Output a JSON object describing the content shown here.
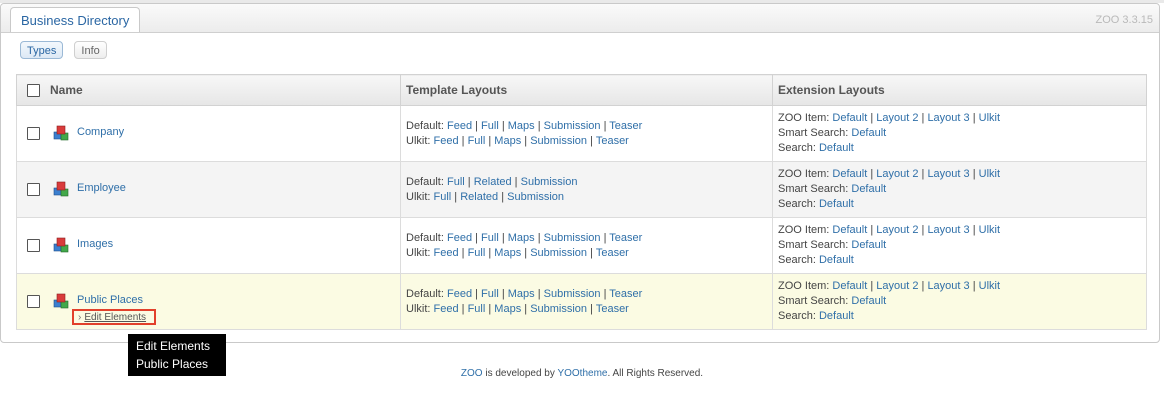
{
  "app_tab": "Business Directory",
  "version": "ZOO 3.3.15",
  "subtabs": {
    "types": "Types",
    "info": "Info"
  },
  "table": {
    "headers": {
      "name": "Name",
      "template": "Template Layouts",
      "extension": "Extension Layouts"
    },
    "rows": [
      {
        "name": "Company",
        "template": [
          {
            "label": "Default:",
            "links": [
              "Feed",
              "Full",
              "Maps",
              "Submission",
              "Teaser"
            ]
          },
          {
            "label": "Ulkit:",
            "links": [
              "Feed",
              "Full",
              "Maps",
              "Submission",
              "Teaser"
            ]
          }
        ],
        "extension": [
          {
            "label": "ZOO Item:",
            "links": [
              "Default",
              "Layout 2",
              "Layout 3",
              "Ulkit"
            ]
          },
          {
            "label": "Smart Search:",
            "links": [
              "Default"
            ]
          },
          {
            "label": "Search:",
            "links": [
              "Default"
            ]
          }
        ]
      },
      {
        "name": "Employee",
        "template": [
          {
            "label": "Default:",
            "links": [
              "Full",
              "Related",
              "Submission"
            ]
          },
          {
            "label": "Ulkit:",
            "links": [
              "Full",
              "Related",
              "Submission"
            ]
          }
        ],
        "extension": [
          {
            "label": "ZOO Item:",
            "links": [
              "Default",
              "Layout 2",
              "Layout 3",
              "Ulkit"
            ]
          },
          {
            "label": "Smart Search:",
            "links": [
              "Default"
            ]
          },
          {
            "label": "Search:",
            "links": [
              "Default"
            ]
          }
        ]
      },
      {
        "name": "Images",
        "template": [
          {
            "label": "Default:",
            "links": [
              "Feed",
              "Full",
              "Maps",
              "Submission",
              "Teaser"
            ]
          },
          {
            "label": "Ulkit:",
            "links": [
              "Feed",
              "Full",
              "Maps",
              "Submission",
              "Teaser"
            ]
          }
        ],
        "extension": [
          {
            "label": "ZOO Item:",
            "links": [
              "Default",
              "Layout 2",
              "Layout 3",
              "Ulkit"
            ]
          },
          {
            "label": "Smart Search:",
            "links": [
              "Default"
            ]
          },
          {
            "label": "Search:",
            "links": [
              "Default"
            ]
          }
        ]
      },
      {
        "name": "Public Places",
        "edit_elements": "Edit Elements",
        "template": [
          {
            "label": "Default:",
            "links": [
              "Feed",
              "Full",
              "Maps",
              "Submission",
              "Teaser"
            ]
          },
          {
            "label": "Ulkit:",
            "links": [
              "Feed",
              "Full",
              "Maps",
              "Submission",
              "Teaser"
            ]
          }
        ],
        "extension": [
          {
            "label": "ZOO Item:",
            "links": [
              "Default",
              "Layout 2",
              "Layout 3",
              "Ulkit"
            ]
          },
          {
            "label": "Smart Search:",
            "links": [
              "Default"
            ]
          },
          {
            "label": "Search:",
            "links": [
              "Default"
            ]
          }
        ]
      }
    ]
  },
  "tooltip": {
    "line1": "Edit Elements",
    "line2": "Public Places"
  },
  "footer": {
    "link1": "ZOO",
    "text1": " is developed by ",
    "link2": "YOOtheme",
    "text2": ". All Rights Reserved."
  },
  "colors": {
    "link": "#2f6fa8",
    "highlight_row": "#fbfbe3",
    "highlight_border": "#e2402b"
  }
}
